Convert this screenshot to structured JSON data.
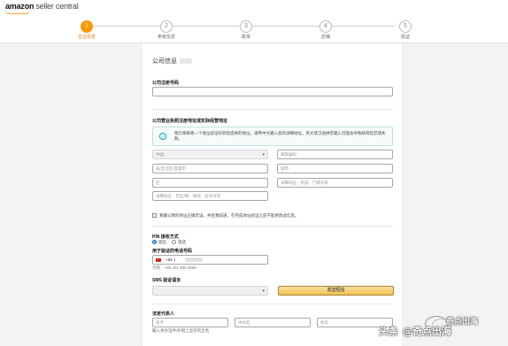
{
  "header": {
    "logo_word": "amazon",
    "logo_suffix": "seller central"
  },
  "steps": [
    {
      "num": "1",
      "label": "企业信息",
      "active": true
    },
    {
      "num": "2",
      "label": "卖家信息",
      "active": false
    },
    {
      "num": "3",
      "label": "账单",
      "active": false
    },
    {
      "num": "4",
      "label": "店铺",
      "active": false
    },
    {
      "num": "5",
      "label": "验证",
      "active": false
    }
  ],
  "form": {
    "section_title": "公司信息",
    "reg_number_label": "公司注册号码",
    "address_label": "公司营业执照注册地址或实际经营地址",
    "info_text": "我们将邮寄一个地址验证码到您提供的地址，请用中文输入您的详细地址。英文或汉语拼音输入可能会导致邮寄延迟或失败。",
    "country_value": "中国",
    "postal_placeholder": "邮政编码",
    "province_placeholder": "省/自治区/直辖市",
    "city_placeholder": "城市",
    "district_placeholder": "区",
    "detail_placeholder": "详细地址：街道、门牌号等",
    "detail2_placeholder": "详细地址：社区/楼、楼层、房间号等",
    "confirm_text": "我确认我的地址正确无误，并且我知道，在完成地址验证之前不能更改此信息。",
    "sms_method_label": "PIN 接收方式",
    "sms_option": "短信",
    "voice_option": "电话",
    "phone_label": "用于验证的电话号码",
    "phone_prefix": "+86 1",
    "phone_example": "示例：+86 201 555 5555",
    "sms_lang_label": "SMS 验证语言",
    "send_button": "发送短信",
    "legal_rep_label": "法定代表人",
    "first_name_placeholder": "名字",
    "middle_name_placeholder": "中间名",
    "last_name_placeholder": "姓氏",
    "name_hint": "输入身份证件/护照上显示的全名"
  },
  "watermark": {
    "source": "头条",
    "account": "@奇点出海",
    "logo_text": "奇点出海"
  },
  "colors": {
    "accent": "#ff9900",
    "button_yellow": "#f0c14b",
    "info_border": "#bde2e6"
  }
}
